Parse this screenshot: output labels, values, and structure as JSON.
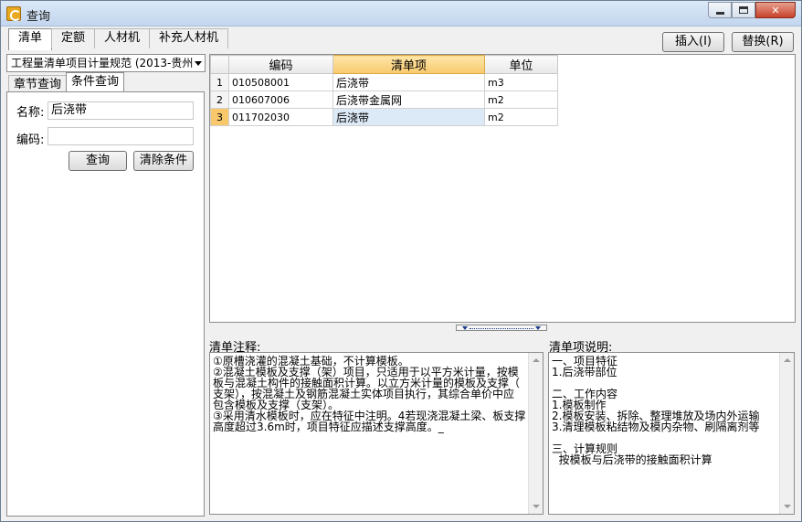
{
  "window": {
    "title": "查询"
  },
  "top_tabs": [
    {
      "label": "清单",
      "active": true
    },
    {
      "label": "定额"
    },
    {
      "label": "人材机"
    },
    {
      "label": "补充人材机"
    }
  ],
  "actions": {
    "insert": "插入(I)",
    "replace": "替换(R)"
  },
  "left": {
    "spec_combo": "工程量清单项目计量规范 (2013-贵州",
    "sub_tabs": [
      {
        "label": "章节查询"
      },
      {
        "label": "条件查询",
        "active": true
      }
    ],
    "name_label": "名称:",
    "name_value": "后浇带",
    "code_label": "编码:",
    "code_value": "",
    "query_button": "查询",
    "clear_button": "清除条件"
  },
  "grid": {
    "columns": [
      "编码",
      "清单项",
      "单位"
    ],
    "rows": [
      {
        "num": "1",
        "code": "010508001",
        "item": "后浇带",
        "unit": "m3"
      },
      {
        "num": "2",
        "code": "010607006",
        "item": "后浇带金属网",
        "unit": "m2"
      },
      {
        "num": "3",
        "code": "011702030",
        "item": "后浇带",
        "unit": "m2"
      }
    ]
  },
  "notes": {
    "label": "清单注释:",
    "text": "①原槽浇灌的混凝土基础，不计算模板。\n②混凝土模板及支撑（架）项目，只适用于以平方米计量，按模\n板与混凝土构件的接触面积计算。以立方米计量的模板及支撑（\n支架），按混凝土及钢筋混凝土实体项目执行，其综合单价中应\n包含模板及支撑（支架）。\n③采用清水模板时，应在特征中注明。4若现浇混凝土梁、板支撑\n高度超过3.6m时，项目特征应描述支撑高度。_"
  },
  "description": {
    "label": "清单项说明:",
    "text": "一、项目特征\n1.后浇带部位\n\n二、工作内容\n1.模板制作\n2.模板安装、拆除、整理堆放及场内外运输\n3.清理模板粘结物及模内杂物、刷隔离剂等\n\n三、计算规则\n  按模板与后浇带的接触面积计算"
  }
}
